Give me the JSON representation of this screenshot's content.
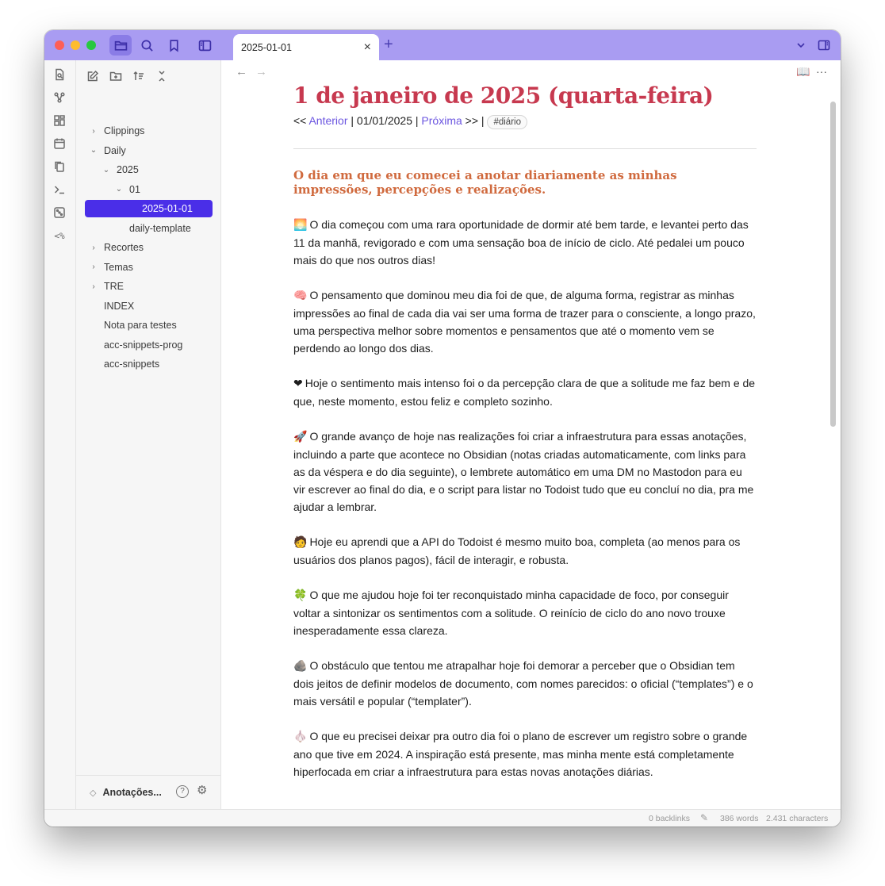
{
  "tab": {
    "title": "2025-01-01",
    "close": "×",
    "new": "+"
  },
  "icons": {
    "titlebar": [
      "folder-icon",
      "search-icon",
      "bookmark-icon",
      "sidebar-toggle-icon"
    ],
    "ribbon": [
      "open-quick-switcher-icon",
      "graph-view-icon",
      "canvas-icon",
      "daily-note-icon",
      "copy-icon",
      "terminal-icon",
      "random-note-icon"
    ],
    "ribbon_text": "<%"
  },
  "sidebar": {
    "tree": [
      {
        "label": "Clippings",
        "chev": "›",
        "level": 0
      },
      {
        "label": "Daily",
        "chev": "⌄",
        "level": 0
      },
      {
        "label": "2025",
        "chev": "⌄",
        "level": 1
      },
      {
        "label": "01",
        "chev": "⌄",
        "level": 2
      },
      {
        "label": "2025-01-01",
        "chev": "",
        "level": 3,
        "selected": true
      },
      {
        "label": "daily-template",
        "chev": "",
        "level": 2
      },
      {
        "label": "Recortes",
        "chev": "›",
        "level": 0
      },
      {
        "label": "Temas",
        "chev": "›",
        "level": 0
      },
      {
        "label": "TRE",
        "chev": "›",
        "level": 0
      },
      {
        "label": "INDEX",
        "chev": "",
        "level": 0
      },
      {
        "label": "Nota para testes",
        "chev": "",
        "level": 0
      },
      {
        "label": "acc-snippets-prog",
        "chev": "",
        "level": 0
      },
      {
        "label": "acc-snippets",
        "chev": "",
        "level": 0
      }
    ],
    "vault": {
      "switch": "◇",
      "name": "Anotações...",
      "help": "?",
      "settings": "⚙"
    }
  },
  "editor": {
    "back": "←",
    "forward": "→",
    "reading_view": "📖",
    "more": "···",
    "title": "1 de janeiro de 2025 (quarta-feira)",
    "nav": {
      "prefix": "<< ",
      "prev_label": "Anterior",
      "sep1": " |  ",
      "date": "01/01/2025",
      "sep2": " |  ",
      "next_label": "Próxima",
      "suffix": " >> | ",
      "tag": "#diário"
    },
    "subheading": "O dia em que eu comecei a anotar diariamente as minhas impressões, percepções e realizações.",
    "paragraphs": [
      {
        "emoji": "🌅",
        "text": "O dia começou com uma rara oportunidade de dormir até bem tarde, e levantei perto das 11 da manhã, revigorado e com uma sensação boa de início de ciclo. Até pedalei um pouco mais do que nos outros dias!"
      },
      {
        "emoji": "🧠",
        "text": "O pensamento que dominou meu dia foi de que, de alguma forma, registrar as minhas impressões ao final de cada dia vai ser uma forma de trazer para o consciente, a longo prazo, uma perspectiva melhor sobre momentos e pensamentos que até o momento vem se perdendo ao longo dos dias."
      },
      {
        "emoji": "❤",
        "text": "Hoje o sentimento mais intenso foi o da percepção clara de que a solitude me faz bem e de que, neste momento, estou feliz e completo sozinho."
      },
      {
        "emoji": "🚀",
        "text": "O grande avanço de hoje nas realizações foi criar a infraestrutura para essas anotações, incluindo a parte que acontece no Obsidian (notas criadas automaticamente, com links para as da véspera e do dia seguinte), o lembrete automático em uma DM no Mastodon para eu vir escrever ao final do dia, e o script para listar no Todoist tudo que eu concluí no dia, pra me ajudar a lembrar."
      },
      {
        "emoji": "🧑",
        "text": "Hoje eu aprendi que a API do Todoist é mesmo muito boa, completa (ao menos para os usuários dos planos pagos), fácil de interagir, e robusta."
      },
      {
        "emoji": "🍀",
        "text": "O que me ajudou hoje foi ter reconquistado minha capacidade de foco, por conseguir voltar a sintonizar os sentimentos com a solitude. O reinício de ciclo do ano novo trouxe inesperadamente essa clareza."
      },
      {
        "emoji": "🪨",
        "text": "O obstáculo que tentou me atrapalhar hoje foi demorar a perceber que o Obsidian tem dois jeitos de definir modelos de documento, com nomes parecidos: o oficial (“templates”) e o mais versátil e popular (“templater”)."
      },
      {
        "emoji": "🧄",
        "text": "O que eu precisei deixar pra outro dia foi o plano de escrever um registro sobre o grande ano que tive em 2024. A inspiração está presente, mas minha mente está completamente hiperfocada em criar a infraestrutura para estas novas anotações diárias."
      }
    ]
  },
  "status": {
    "backlinks": "0 backlinks",
    "edit_icon": "✎",
    "words": "386 words",
    "characters": "2.431 characters"
  }
}
